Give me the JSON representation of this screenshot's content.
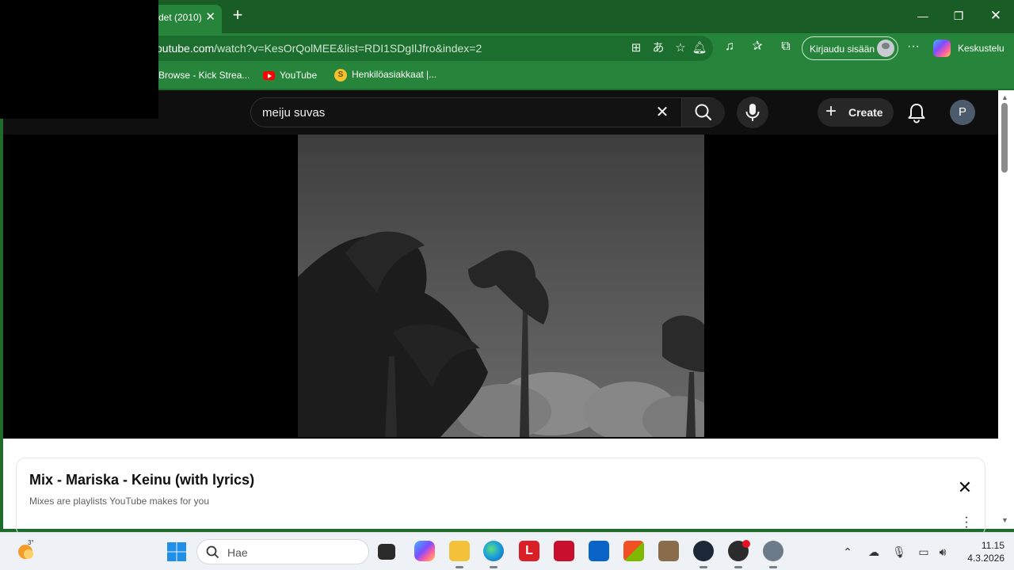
{
  "browser": {
    "tab_title": "det (2010)",
    "url_host": "youtube.com",
    "url_path": "/watch?v=KesOrQolMEE&list=RDI1SDgIlJfro&index=2",
    "signin_label": "Kirjaudu sisään",
    "copilot_label": "Keskustelu",
    "bookmarks": [
      {
        "label": "Browse - Kick Strea..."
      },
      {
        "label": "YouTube"
      },
      {
        "label": "Henkilöasiakkaat |..."
      }
    ]
  },
  "youtube": {
    "search_query": "meiju suvas",
    "create_label": "Create",
    "avatar_letter": "P"
  },
  "playlist": {
    "title": "Mix - Mariska - Keinu (with lyrics)",
    "subtitle": "Mixes are playlists YouTube makes for you"
  },
  "taskbar": {
    "weather_temp": "3°",
    "search_placeholder": "Hae",
    "time": "11.15",
    "date": "4.3.2026"
  },
  "colors": {
    "browser_frame": "#26853a",
    "tabbar": "#1a5c26",
    "youtube_bg": "#0f0f0f",
    "accent_red": "#ff0000"
  }
}
